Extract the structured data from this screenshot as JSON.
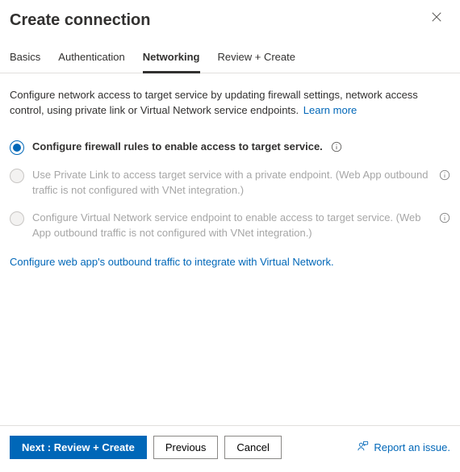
{
  "panel": {
    "title": "Create connection"
  },
  "tabs": [
    {
      "label": "Basics"
    },
    {
      "label": "Authentication"
    },
    {
      "label": "Networking",
      "active": true
    },
    {
      "label": "Review + Create"
    }
  ],
  "body": {
    "description": "Configure network access to target service by updating firewall settings, network access control, using private link or Virtual Network service endpoints.",
    "learn_more": "Learn more"
  },
  "options": [
    {
      "label": "Configure firewall rules to enable access to target service.",
      "checked": true,
      "disabled": false
    },
    {
      "label": "Use Private Link to access target service with a private endpoint. (Web App outbound traffic is not configured with VNet integration.)",
      "checked": false,
      "disabled": true
    },
    {
      "label": "Configure Virtual Network service endpoint to enable access to target service. (Web App outbound traffic is not configured with VNet integration.)",
      "checked": false,
      "disabled": true
    }
  ],
  "trailing_link": "Configure web app's outbound traffic to integrate with Virtual Network.",
  "footer": {
    "next": "Next : Review + Create",
    "previous": "Previous",
    "cancel": "Cancel",
    "report": "Report an issue."
  }
}
